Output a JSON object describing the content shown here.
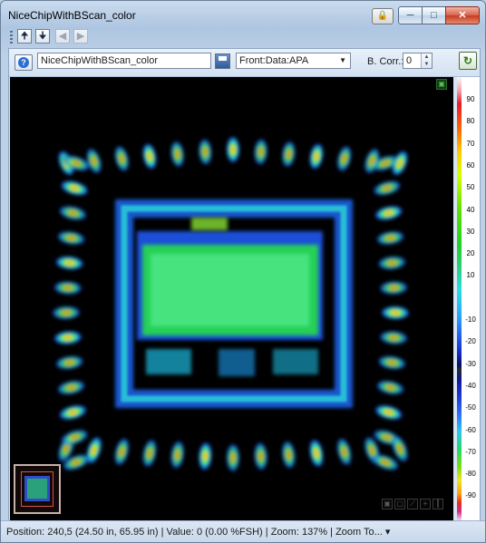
{
  "window": {
    "title": "NiceChipWithBScan_color",
    "minimize_icon": "minimize-icon",
    "maximize_icon": "maximize-icon",
    "close_icon": "close-icon",
    "lock_icon": "lock-icon"
  },
  "toolbar": {
    "buttons": [
      {
        "icon": "export-up-icon",
        "enabled": true
      },
      {
        "icon": "import-down-icon",
        "enabled": true
      },
      {
        "icon": "back-icon",
        "enabled": false
      },
      {
        "icon": "forward-icon",
        "enabled": false
      }
    ]
  },
  "scan_toolbar": {
    "help_icon": "help-icon",
    "name_value": "NiceChipWithBScan_color",
    "save_icon": "save-icon",
    "view_select_value": "Front:Data:APA",
    "bcorr_label": "B. Corr.:",
    "bcorr_value": "0",
    "refresh_icon": "refresh-icon"
  },
  "colors": {
    "scan_background": "#000000",
    "thumbnail_border": "#c6b2a9",
    "accent": "#2a6fd1"
  },
  "colorbar": {
    "ticks": [
      "90",
      "80",
      "70",
      "60",
      "50",
      "40",
      "30",
      "20",
      "10",
      "0",
      "-10",
      "-20",
      "-30",
      "-40",
      "-50",
      "-60",
      "-70",
      "-80",
      "-90"
    ]
  },
  "zoom_tools": [
    "zoom-fit-icon",
    "zoom-rect-icon",
    "measure-icon",
    "crosshair-icon",
    "split-icon"
  ],
  "status": {
    "position": "Position: 240,5 (24.50 in, 65.95 in)",
    "value": "Value: 0 (0.00 %FSH)",
    "zoom": "Zoom: 137%",
    "zoom_to": "Zoom To...",
    "separator": " | "
  }
}
